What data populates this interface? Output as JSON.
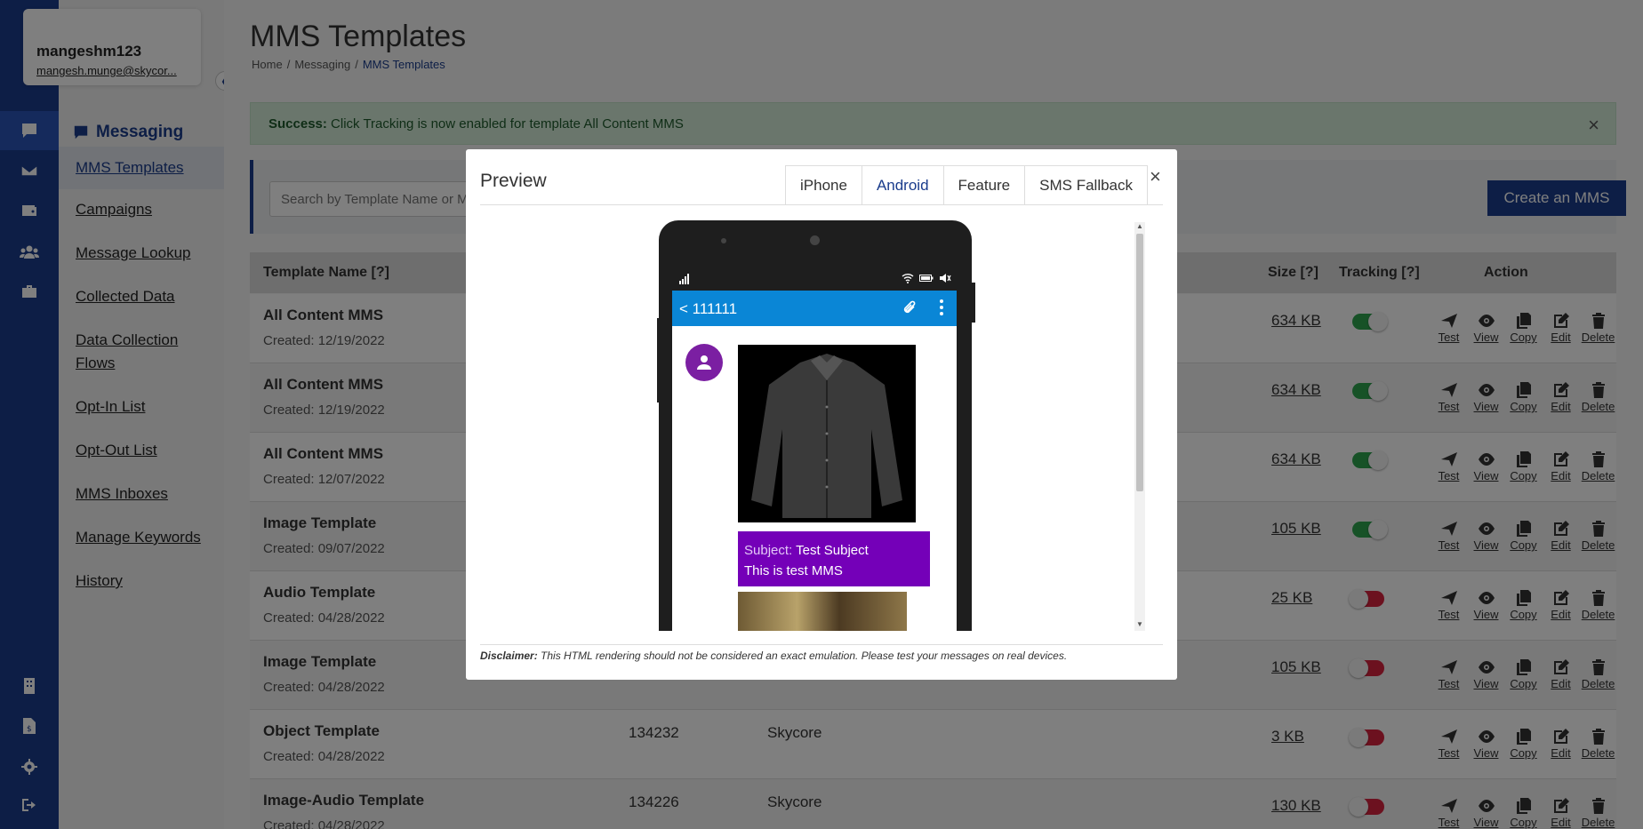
{
  "user": {
    "name": "mangeshm123",
    "email": "mangesh.munge@skycor..."
  },
  "rail": {
    "icons": [
      "chat-icon",
      "mail-icon",
      "wallet-icon",
      "users-icon",
      "toolbox-icon",
      "building-icon",
      "file-dollar-icon",
      "gear-icon",
      "sign-out-icon"
    ]
  },
  "subnav": {
    "title": "Messaging",
    "items": [
      {
        "label": "MMS Templates"
      },
      {
        "label": "Campaigns"
      },
      {
        "label": "Message Lookup"
      },
      {
        "label": "Collected Data"
      },
      {
        "label": "Data Collection Flows"
      },
      {
        "label": "Opt-In List"
      },
      {
        "label": "Opt-Out List"
      },
      {
        "label": "MMS Inboxes"
      },
      {
        "label": "Manage Keywords"
      },
      {
        "label": "History"
      }
    ]
  },
  "page": {
    "title": "MMS Templates"
  },
  "breadcrumb": {
    "home": "Home",
    "section": "Messaging",
    "current": "MMS Templates",
    "separator": "/"
  },
  "alert": {
    "strong": "Success:",
    "text": "Click Tracking is now enabled for template All Content MMS",
    "close": "×"
  },
  "search": {
    "placeholder": "Search by Template Name or MMS ID"
  },
  "create_button": "Create an MMS",
  "table": {
    "headers": {
      "name": "Template Name [?]",
      "size": "Size [?]",
      "tracking": "Tracking [?]",
      "action": "Action"
    },
    "action_labels": {
      "test": "Test",
      "view": "View",
      "copy": "Copy",
      "edit": "Edit",
      "delete": "Delete"
    },
    "rows": [
      {
        "name": "All Content MMS",
        "created": "Created: 12/19/2022",
        "id": "",
        "account": "",
        "size": "634 KB",
        "tracking": true
      },
      {
        "name": "All Content MMS",
        "created": "Created: 12/19/2022",
        "id": "",
        "account": "",
        "size": "634 KB",
        "tracking": true
      },
      {
        "name": "All Content MMS",
        "created": "Created: 12/07/2022",
        "id": "",
        "account": "",
        "size": "634 KB",
        "tracking": true
      },
      {
        "name": "Image Template",
        "created": "Created: 09/07/2022",
        "id": "",
        "account": "",
        "size": "105 KB",
        "tracking": true
      },
      {
        "name": "Audio Template",
        "created": "Created: 04/28/2022",
        "id": "",
        "account": "",
        "size": "25 KB",
        "tracking": false
      },
      {
        "name": "Image Template",
        "created": "Created: 04/28/2022",
        "id": "",
        "account": "",
        "size": "105 KB",
        "tracking": false
      },
      {
        "name": "Object Template",
        "created": "Created: 04/28/2022",
        "id": "134232",
        "account": "Skycore",
        "size": "3 KB",
        "tracking": false
      },
      {
        "name": "Image-Audio Template",
        "created": "Created: 04/28/2022",
        "id": "134226",
        "account": "Skycore",
        "size": "130 KB",
        "tracking": false
      }
    ]
  },
  "modal": {
    "title": "Preview",
    "close": "×",
    "tabs": [
      "iPhone",
      "Android",
      "Feature",
      "SMS Fallback"
    ],
    "active_tab": "Android",
    "disclaimer_label": "Disclaimer:",
    "disclaimer_text": "This HTML rendering should not be considered an exact emulation. Please test your messages on real devices.",
    "phone": {
      "contact": "< 111111",
      "subject_label": "Subject:",
      "subject": "Test Subject",
      "body": "This is test MMS"
    }
  },
  "colors": {
    "brand": "#1a3c8c",
    "success_bg": "#d4ecd9",
    "toggle_on": "#2ea44f",
    "toggle_off": "#d9233f",
    "bubble": "#7400b8",
    "android_bar": "#0a86d6"
  }
}
